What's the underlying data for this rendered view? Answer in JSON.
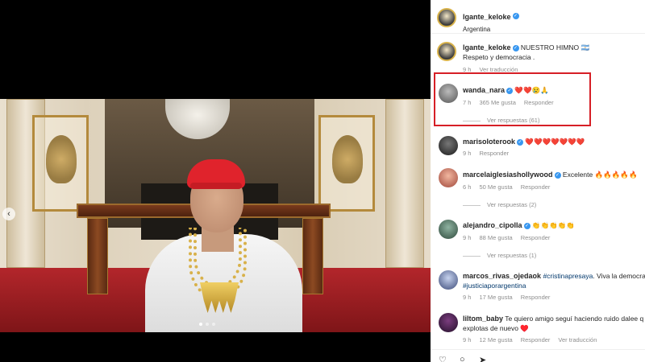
{
  "post": {
    "author": "lgante_keloke",
    "location": "Argentina"
  },
  "caption": {
    "author": "lgante_keloke",
    "text_line1": "NUESTRO HIMNO 🇦🇷",
    "text_line2": "Respeto y democracia .",
    "time": "9 h",
    "translate": "Ver traducción"
  },
  "comments": [
    {
      "author": "wanda_nara",
      "verified": true,
      "text": "❤️❤️😢🙏",
      "time": "7 h",
      "likes": "365 Me gusta",
      "reply_label": "Responder",
      "view_replies": "Ver respuestas (61)"
    },
    {
      "author": "marisoloterook",
      "verified": true,
      "text": "❤️❤️❤️❤️❤️❤️❤️",
      "time": "9 h",
      "likes": "",
      "reply_label": "Responder",
      "view_replies": ""
    },
    {
      "author": "marcelaiglesiashollywood",
      "verified": true,
      "text": "Excelente 🔥🔥🔥🔥🔥",
      "time": "6 h",
      "likes": "50 Me gusta",
      "reply_label": "Responder",
      "view_replies": "Ver respuestas (2)"
    },
    {
      "author": "alejandro_cipolla",
      "verified": true,
      "text": "👏👏👏👏👏",
      "time": "9 h",
      "likes": "88 Me gusta",
      "reply_label": "Responder",
      "view_replies": "Ver respuestas (1)"
    },
    {
      "author": "marcos_rivas_ojedaok",
      "verified": false,
      "text_parts": [
        "#cristinapresaya",
        ". Viva la democracia",
        "#justiciaporargentina"
      ],
      "time": "9 h",
      "likes": "17 Me gusta",
      "reply_label": "Responder",
      "view_replies": ""
    },
    {
      "author": "liltom_baby",
      "verified": false,
      "text": "Te quiero amigo seguí haciendo ruido dalee q",
      "text_line2": "explotas de nuevo ♥️",
      "time": "9 h",
      "likes": "12 Me gusta",
      "reply_label": "Responder",
      "translate": "Ver traducción"
    }
  ],
  "carousel": {
    "prev_glyph": "‹"
  },
  "actions": {
    "like_icon": "♡",
    "comment_icon": "○",
    "share_icon": "➤"
  },
  "colors": {
    "highlight": "#d61f26",
    "verified": "#3897f0",
    "hashtag": "#00376b"
  }
}
